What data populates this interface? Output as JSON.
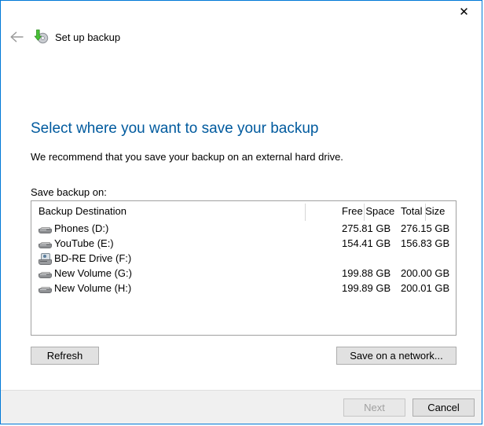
{
  "window": {
    "close_label": "✕",
    "back_label": "back-arrow",
    "title": "Set up backup",
    "accent_color": "#0078d7",
    "heading_color": "#005a9e"
  },
  "page": {
    "heading": "Select where you want to save your backup",
    "subtext": "We recommend that you save your backup on an external hard drive.",
    "field_label": "Save backup on:"
  },
  "table": {
    "columns": [
      "Backup Destination",
      "Free Space",
      "Total Size"
    ],
    "rows": [
      {
        "icon": "hard-drive-icon",
        "name": "Phones (D:)",
        "free_space": "275.81 GB",
        "total_size": "276.15 GB"
      },
      {
        "icon": "hard-drive-icon",
        "name": "YouTube (E:)",
        "free_space": "154.41 GB",
        "total_size": "156.83 GB"
      },
      {
        "icon": "optical-drive-icon",
        "name": "BD-RE Drive (F:)",
        "free_space": "",
        "total_size": ""
      },
      {
        "icon": "hard-drive-icon",
        "name": "New Volume (G:)",
        "free_space": "199.88 GB",
        "total_size": "200.00 GB"
      },
      {
        "icon": "hard-drive-icon",
        "name": "New Volume (H:)",
        "free_space": "199.89 GB",
        "total_size": "200.01 GB"
      }
    ]
  },
  "actions": {
    "refresh": "Refresh",
    "save_on_network": "Save on a network..."
  },
  "footer": {
    "next": "Next",
    "next_disabled": true,
    "cancel": "Cancel"
  }
}
